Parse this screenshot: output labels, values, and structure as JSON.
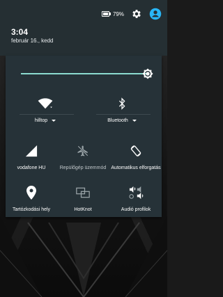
{
  "status_bar": {
    "battery_percent": "79%",
    "battery_level": 0.79,
    "icons": [
      "battery-icon",
      "settings-icon",
      "user-account-icon"
    ]
  },
  "header": {
    "time": "3:04",
    "date": "február 16., kedd"
  },
  "brightness": {
    "level": 1.0
  },
  "tiles": {
    "wifi": {
      "label": "hilltop",
      "icon": "wifi-icon"
    },
    "bluetooth": {
      "label": "Bluetooth",
      "icon": "bluetooth-icon"
    },
    "cellular": {
      "label": "vodafone HU",
      "icon": "cellular-signal-icon"
    },
    "airplane": {
      "label": "Repülőgép üzemmód",
      "icon": "airplane-mode-icon"
    },
    "rotation": {
      "label": "Automatikus elforgatás",
      "icon": "auto-rotate-icon"
    },
    "hotspot": {
      "label": "Tartózkodási hely",
      "icon": "location-icon"
    },
    "hotknot": {
      "label": "HotKnot",
      "icon": "hotknot-icon"
    },
    "audio": {
      "label": "Audió profilok",
      "icon": "audio-profile-icon"
    }
  },
  "colors": {
    "accent": "#8cdcd0",
    "panel": "#263238",
    "header": "#252f33",
    "user_icon": "#29b6f6"
  }
}
